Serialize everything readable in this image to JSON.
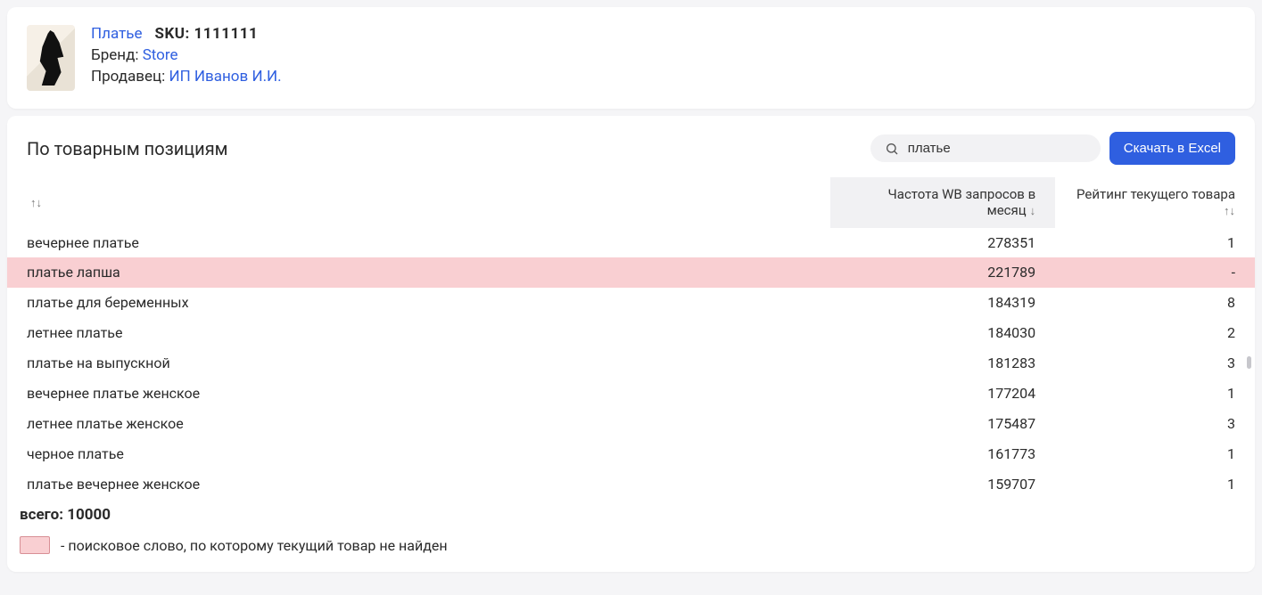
{
  "product": {
    "title": "Платье",
    "sku_label": "SKU:",
    "sku_value": "1111111",
    "brand_label": "Бренд:",
    "brand_value": "Store",
    "seller_label": "Продавец:",
    "seller_value": "ИП Иванов И.И."
  },
  "section": {
    "title": "По товарным позициям"
  },
  "search": {
    "value": "платье"
  },
  "buttons": {
    "excel": "Скачать в Excel"
  },
  "columns": {
    "c1": "",
    "c2": "Частота WB запросов в месяц",
    "c3": "Рейтинг текущего товара"
  },
  "rows": [
    {
      "q": "вечернее платье",
      "freq": "278351",
      "rank": "1",
      "hl": false
    },
    {
      "q": "платье лапша",
      "freq": "221789",
      "rank": "-",
      "hl": true
    },
    {
      "q": "платье для беременных",
      "freq": "184319",
      "rank": "8",
      "hl": false
    },
    {
      "q": "летнее платье",
      "freq": "184030",
      "rank": "2",
      "hl": false
    },
    {
      "q": "платье на выпускной",
      "freq": "181283",
      "rank": "3",
      "hl": false
    },
    {
      "q": "вечернее платье женское",
      "freq": "177204",
      "rank": "1",
      "hl": false
    },
    {
      "q": "летнее платье женское",
      "freq": "175487",
      "rank": "3",
      "hl": false
    },
    {
      "q": "черное платье",
      "freq": "161773",
      "rank": "1",
      "hl": false
    },
    {
      "q": "платье вечернее женское",
      "freq": "159707",
      "rank": "1",
      "hl": false
    }
  ],
  "totals": {
    "label": "всего:",
    "value": "10000"
  },
  "legend": {
    "text": "- поисковое слово, по которому текущий товар не найден"
  }
}
